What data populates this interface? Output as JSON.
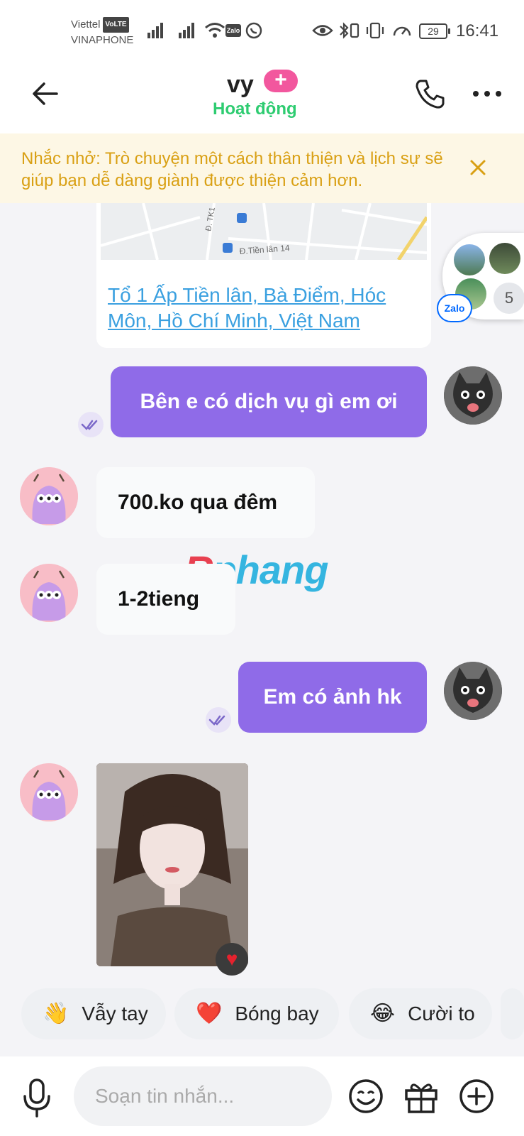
{
  "status_bar": {
    "carrier1": "Viettel",
    "volte": "VoLTE",
    "carrier2": "VINAPHONE",
    "battery": "29",
    "time": "16:41"
  },
  "header": {
    "title": "vy",
    "badge": "+",
    "status": "Hoạt động"
  },
  "reminder": {
    "text": "Nhắc nhở: Trò chuyện một cách thân thiện và lịch sự sẽ giúp bạn dễ dàng giành được thiện cảm hơn."
  },
  "map_card": {
    "street1": "Đ. TK1",
    "street2": "Đ.Tiền lân 14",
    "address": "Tổ 1 Ấp Tiền lân, Bà Điểm, Hóc Môn, Hồ Chí Minh, Việt Nam"
  },
  "float_widget": {
    "count": "5",
    "brand": "Zalo"
  },
  "messages": [
    {
      "direction": "out",
      "text": "Bên e có dịch vụ gì em ơi"
    },
    {
      "direction": "in",
      "text": "700.ko qua đêm"
    },
    {
      "direction": "in",
      "text": "1-2tieng"
    },
    {
      "direction": "out",
      "text": "Em có ảnh hk"
    }
  ],
  "watermark": {
    "part1": "R",
    "part2": "phang"
  },
  "quick_replies": [
    {
      "emoji": "👋",
      "label": "Vẫy tay"
    },
    {
      "emoji": "❤️",
      "label": "Bóng bay"
    },
    {
      "emoji": "😂",
      "label": "Cười to"
    }
  ],
  "composer": {
    "placeholder": "Soạn tin nhắn..."
  },
  "colors": {
    "accent": "#8f6be8",
    "online": "#2ecc71",
    "reminder": "#d9a014",
    "link": "#3aa0e0"
  }
}
